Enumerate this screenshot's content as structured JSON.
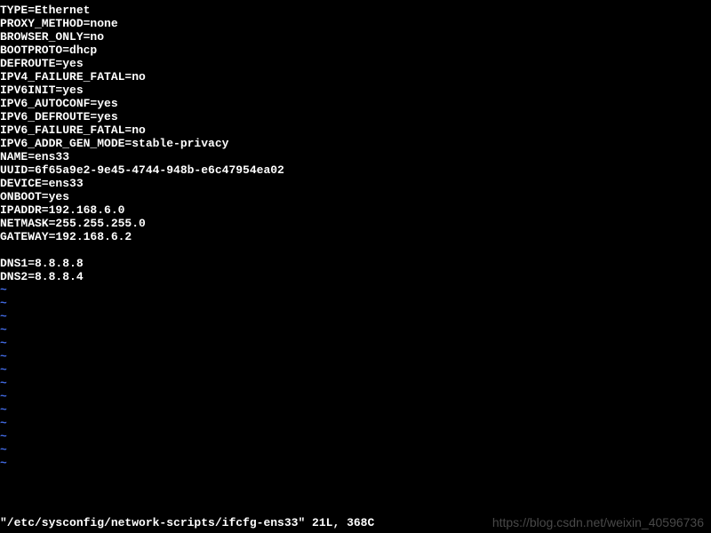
{
  "config_lines": [
    "TYPE=Ethernet",
    "PROXY_METHOD=none",
    "BROWSER_ONLY=no",
    "BOOTPROTO=dhcp",
    "DEFROUTE=yes",
    "IPV4_FAILURE_FATAL=no",
    "IPV6INIT=yes",
    "IPV6_AUTOCONF=yes",
    "IPV6_DEFROUTE=yes",
    "IPV6_FAILURE_FATAL=no",
    "IPV6_ADDR_GEN_MODE=stable-privacy",
    "NAME=ens33",
    "UUID=6f65a9e2-9e45-4744-948b-e6c47954ea02",
    "DEVICE=ens33",
    "ONBOOT=yes",
    "IPADDR=192.168.6.0",
    "NETMASK=255.255.255.0",
    "GATEWAY=192.168.6.2"
  ],
  "dns_lines": [
    "DNS1=8.8.8.8",
    "DNS2=8.8.8.4"
  ],
  "tilde": "~",
  "tilde_count": 14,
  "status_line": "\"/etc/sysconfig/network-scripts/ifcfg-ens33\" 21L, 368C",
  "watermark": "https://blog.csdn.net/weixin_40596736"
}
